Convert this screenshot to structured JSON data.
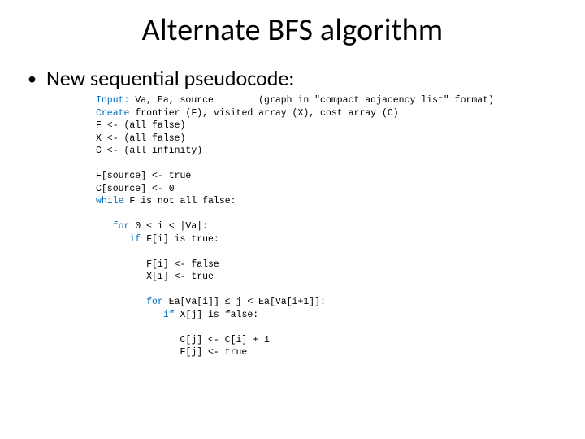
{
  "title": "Alternate BFS algorithm",
  "bullet": "New sequential pseudocode:",
  "code": {
    "l01a": "Input:",
    "l01b": " Va, Ea, source        (graph in \"compact adjacency list\" format)",
    "l02a": "Create",
    "l02b": " frontier (F), visited array (X), cost array (C)",
    "l03": "F <- (all false)",
    "l04": "X <- (all false)",
    "l05": "C <- (all infinity)",
    "l06": "",
    "l07": "F[source] <- true",
    "l08": "C[source] <- 0",
    "l09a": "while",
    "l09b": " F is not all false:",
    "l10": "",
    "l11a": "   for",
    "l11b": " 0 ≤ i < |Va|:",
    "l12a": "      if",
    "l12b": " F[i] is true:",
    "l13": "",
    "l14": "         F[i] <- false",
    "l15": "         X[i] <- true",
    "l16": "",
    "l17a": "         for",
    "l17b": " Ea[Va[i]] ≤ j < Ea[Va[i+1]]:",
    "l18a": "            if",
    "l18b": " X[j] is false:",
    "l19": "",
    "l20": "               C[j] <- C[i] + 1",
    "l21": "               F[j] <- true"
  }
}
